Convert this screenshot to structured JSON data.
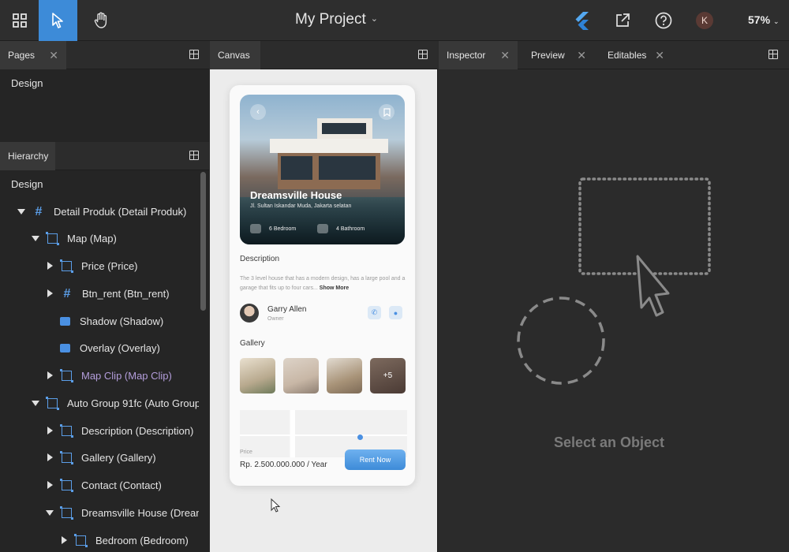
{
  "topbar": {
    "project_title": "My Project",
    "avatar_initial": "K",
    "zoom": "57%",
    "accent": "#3d8bd8"
  },
  "pages_panel": {
    "tab_label": "Pages",
    "items": [
      "Design"
    ]
  },
  "hierarchy_panel": {
    "tab_label": "Hierarchy",
    "root": "Design",
    "items": [
      {
        "label": "Detail Produk (Detail Produk)",
        "icon": "hash-icon",
        "expander": "down"
      },
      {
        "label": "Map (Map)",
        "icon": "frame-icon",
        "expander": "down"
      },
      {
        "label": "Price (Price)",
        "icon": "frame-icon",
        "expander": "right"
      },
      {
        "label": "Btn_rent (Btn_rent)",
        "icon": "hash-icon",
        "expander": "right"
      },
      {
        "label": "Shadow (Shadow)",
        "icon": "rect-icon",
        "expander": "none"
      },
      {
        "label": "Overlay (Overlay)",
        "icon": "rect-icon",
        "expander": "none"
      },
      {
        "label": "Map Clip (Map Clip)",
        "icon": "frame-icon",
        "expander": "right"
      },
      {
        "label": "Auto Group 91fc (Auto Group",
        "icon": "frame-icon",
        "expander": "down"
      },
      {
        "label": "Description (Description)",
        "icon": "frame-icon",
        "expander": "right"
      },
      {
        "label": "Gallery (Gallery)",
        "icon": "frame-icon",
        "expander": "right"
      },
      {
        "label": "Contact (Contact)",
        "icon": "frame-icon",
        "expander": "right"
      },
      {
        "label": "Dreamsville House (Dream",
        "icon": "frame-icon",
        "expander": "down"
      },
      {
        "label": "Bedroom (Bedroom)",
        "icon": "frame-icon",
        "expander": "right"
      }
    ]
  },
  "canvas_panel": {
    "tab_label": "Canvas",
    "app": {
      "house_title": "Dreamsville House",
      "address": "Jl. Sultan Iskandar Muda, Jakarta selatan",
      "bedrooms": "6 Bedroom",
      "bathrooms": "4 Bathroom",
      "description_heading": "Description",
      "description_text": "The 3 level house that has a modern design, has a large pool and a garage that fits up to four cars... ",
      "show_more": "Show More",
      "owner_name": "Garry Allen",
      "owner_role": "Owner",
      "gallery_heading": "Gallery",
      "gallery_more": "+5",
      "price_label": "Price",
      "price_value": "Rp. 2.500.000.000 / Year",
      "rent_button": "Rent Now"
    }
  },
  "inspector_panel": {
    "tabs": [
      "Inspector",
      "Preview",
      "Editables"
    ],
    "empty_state": "Select an Object"
  }
}
